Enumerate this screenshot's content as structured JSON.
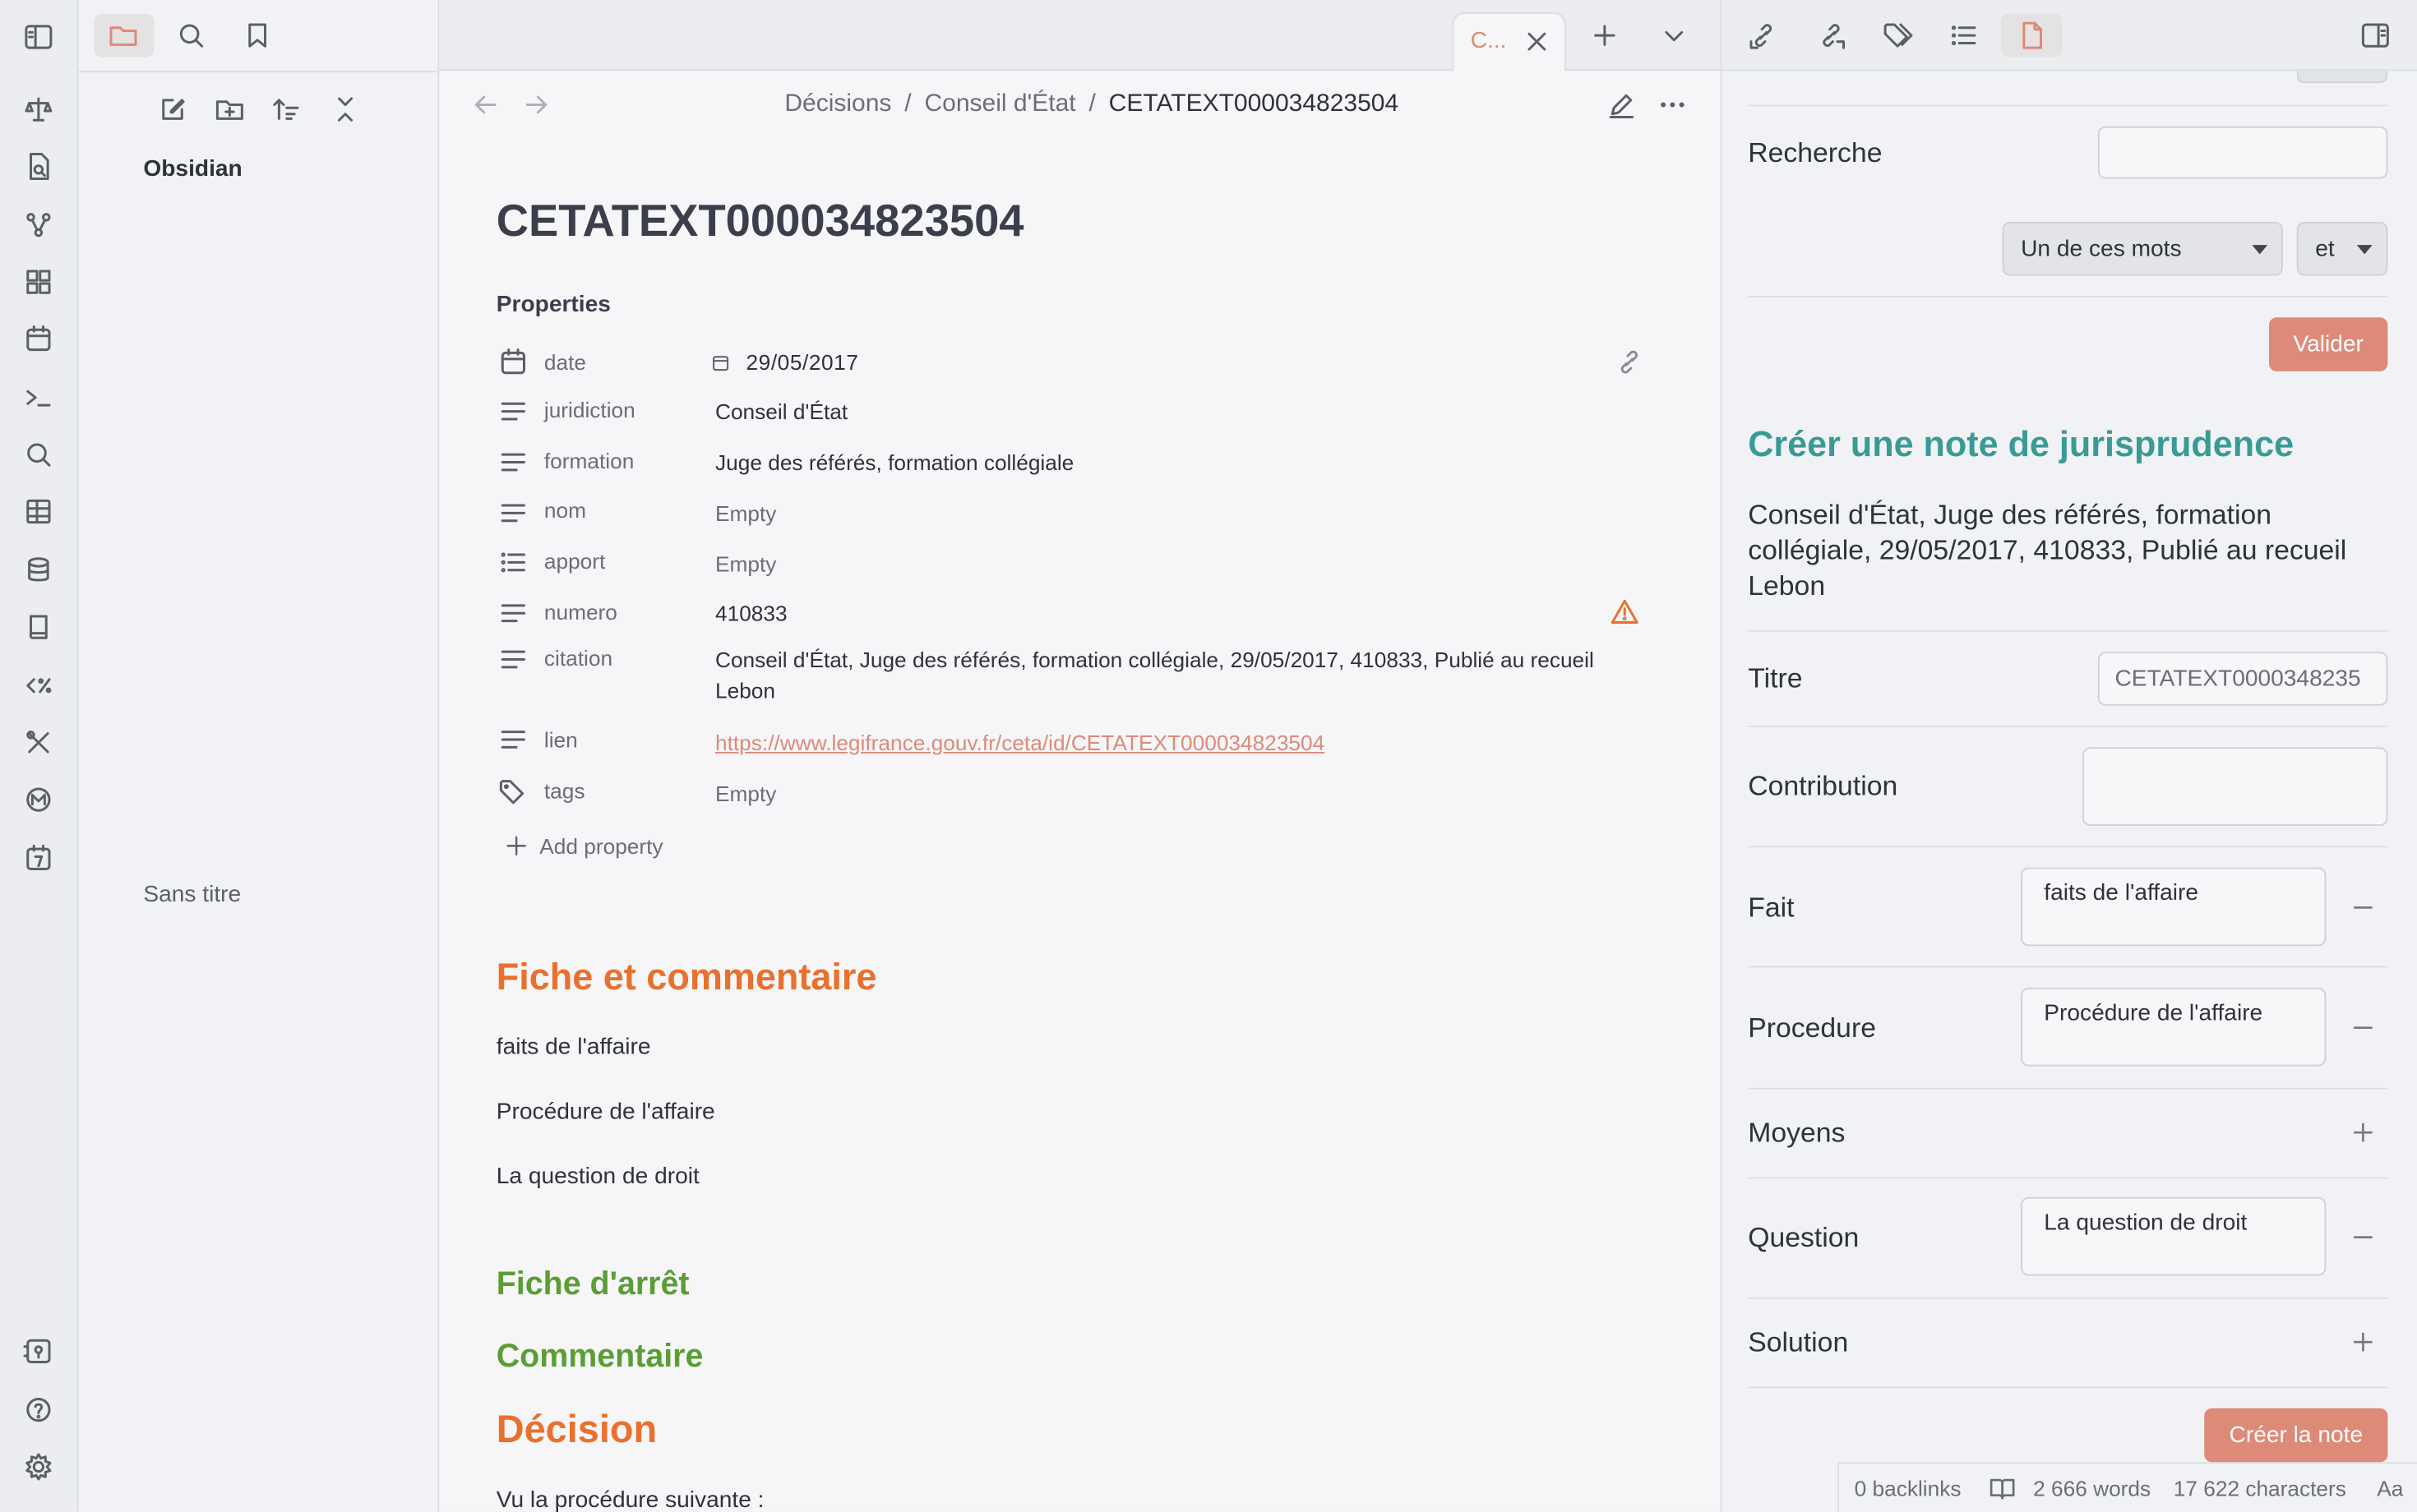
{
  "tab": {
    "label": "C..."
  },
  "breadcrumb": {
    "part1": "Décisions",
    "sep1": "/",
    "part2": "Conseil d'État",
    "sep2": "/",
    "part3": "CETATEXT000034823504"
  },
  "vault": {
    "name": "Obsidian",
    "file": "Sans titre"
  },
  "note": {
    "title": "CETATEXT000034823504",
    "properties_label": "Properties",
    "properties": [
      {
        "key": "date",
        "value": "29/05/2017",
        "icon": "calendar-icon"
      },
      {
        "key": "juridiction",
        "value": "Conseil d'État",
        "icon": "text-icon"
      },
      {
        "key": "formation",
        "value": "Juge des référés, formation collégiale",
        "icon": "text-icon"
      },
      {
        "key": "nom",
        "value": "Empty",
        "icon": "text-icon"
      },
      {
        "key": "apport",
        "value": "Empty",
        "icon": "list-icon"
      },
      {
        "key": "numero",
        "value": "410833",
        "icon": "text-icon"
      },
      {
        "key": "citation",
        "value1": "Conseil d'État, Juge des référés, formation collégiale, 29/05/2017, 410833, Publié au recueil",
        "value2": "Lebon",
        "icon": "text-icon"
      },
      {
        "key": "lien",
        "value": "https://www.legifrance.gouv.fr/ceta/id/CETATEXT000034823504",
        "icon": "text-icon"
      },
      {
        "key": "tags",
        "value": "Empty",
        "icon": "tags-icon"
      }
    ],
    "add_property": "Add property",
    "h_fiche_commentaire": "Fiche et commentaire",
    "p1": "faits de l'affaire",
    "p2": "Procédure de l'affaire",
    "p3": "La question de droit",
    "h_fiche_arret": "Fiche d'arrêt",
    "h_commentaire": "Commentaire",
    "h_decision": "Décision",
    "p4": "Vu la procédure suivante :"
  },
  "panel": {
    "recherche_label": "Recherche",
    "recherche_value": "",
    "mode_select": "Un de ces mots",
    "op_select": "et",
    "valider": "Valider",
    "heading": "Créer une note de jurisprudence",
    "citation1": "Conseil d'État, Juge des référés, formation",
    "citation2": "collégiale, 29/05/2017, 410833, Publié au recueil",
    "citation3": "Lebon",
    "titre_label": "Titre",
    "titre_value": "CETATEXT0000348235",
    "contribution_label": "Contribution",
    "fait_label": "Fait",
    "fait_value": "faits de l'affaire",
    "procedure_label": "Procedure",
    "procedure_value": "Procédure de l'affaire",
    "moyens_label": "Moyens",
    "question_label": "Question",
    "question_value": "La question de droit",
    "solution_label": "Solution",
    "creer": "Créer la note"
  },
  "status": {
    "backlinks": "0 backlinks",
    "words": "2 666 words",
    "chars": "17 622 characters",
    "aa": "Aa"
  },
  "colors": {
    "accent": "#dd8a78",
    "orange_heading": "#e8712e",
    "green_heading": "#5a9e34",
    "teal_heading": "#3a9a96"
  }
}
